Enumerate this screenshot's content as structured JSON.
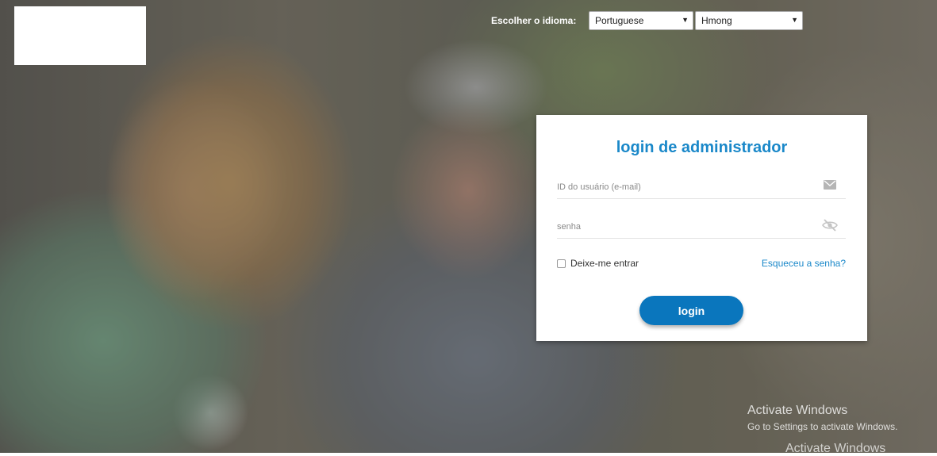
{
  "language": {
    "label": "Escolher o idioma:",
    "primary": "Portuguese",
    "secondary": "Hmong"
  },
  "login": {
    "title": "login de administrador",
    "user_placeholder": "ID do usuário (e-mail)",
    "password_placeholder": "senha",
    "remember_label": "Deixe-me entrar",
    "forgot_label": "Esqueceu a senha?",
    "submit_label": "login"
  },
  "watermark": {
    "title": "Activate Windows",
    "subtitle": "Go to Settings to activate Windows.",
    "repeat": "Activate Windows"
  },
  "colors": {
    "accent": "#1a88c9",
    "button": "#0a76bd"
  }
}
